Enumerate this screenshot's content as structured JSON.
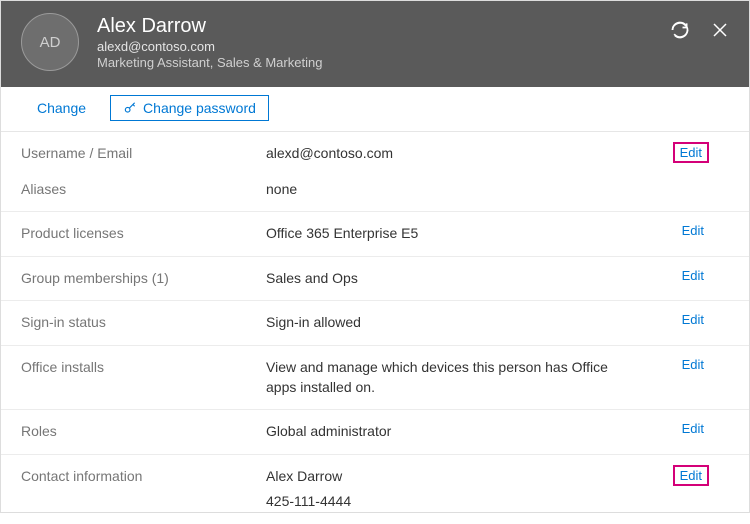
{
  "header": {
    "initials": "AD",
    "name": "Alex Darrow",
    "email": "alexd@contoso.com",
    "role": "Marketing Assistant, Sales & Marketing"
  },
  "actions": {
    "change": "Change",
    "change_password": "Change password"
  },
  "rows": {
    "username_label": "Username / Email",
    "username_value": "alexd@contoso.com",
    "aliases_label": "Aliases",
    "aliases_value": "none",
    "licenses_label": "Product licenses",
    "licenses_value": "Office 365 Enterprise E5",
    "groups_label": "Group memberships (1)",
    "groups_value": "Sales and Ops",
    "signin_label": "Sign-in status",
    "signin_value": "Sign-in allowed",
    "office_label": "Office installs",
    "office_value": "View and manage which devices this person has Office apps installed on.",
    "roles_label": "Roles",
    "roles_value": "Global administrator",
    "contact_label": "Contact information",
    "contact_name": "Alex Darrow",
    "contact_phone": "425-111-4444"
  },
  "edit_label": "Edit"
}
